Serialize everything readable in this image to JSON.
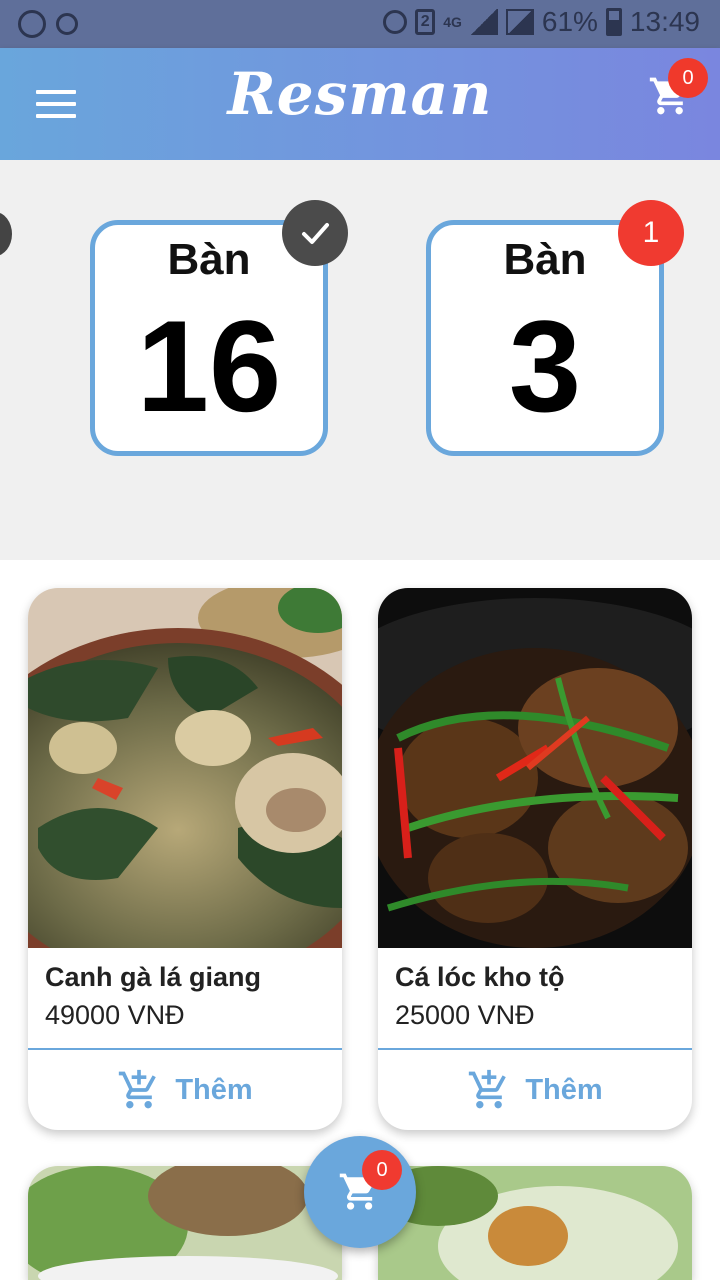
{
  "status": {
    "signal": "4G",
    "battery": "61%",
    "time": "13:49",
    "sim": "2"
  },
  "app": {
    "title": "Resman",
    "cart_count": "0"
  },
  "tables": [
    {
      "label": "Bàn",
      "number": "16",
      "status": "checked"
    },
    {
      "label": "Bàn",
      "number": "3",
      "badge": "1"
    }
  ],
  "foods": [
    {
      "name": "Canh gà lá giang",
      "price": "49000 VNĐ",
      "add_label": "Thêm"
    },
    {
      "name": "Cá lóc kho tộ",
      "price": "25000 VNĐ",
      "add_label": "Thêm"
    }
  ],
  "fab": {
    "cart_count": "0"
  },
  "colors": {
    "accent": "#6aa7dc",
    "badge": "#f03a30",
    "header_start": "#69a6dc",
    "header_end": "#7a86df"
  }
}
